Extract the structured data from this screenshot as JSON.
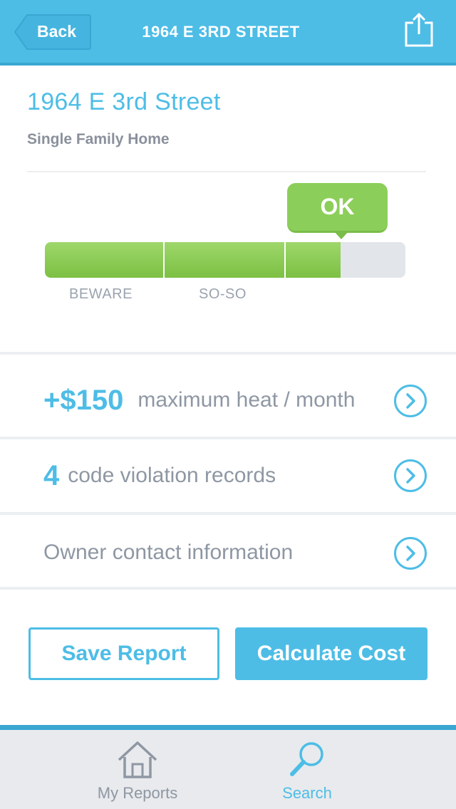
{
  "header": {
    "back_label": "Back",
    "title": "1964 E 3RD STREET",
    "share_icon": "share-icon"
  },
  "property": {
    "address": "1964 E 3rd Street",
    "type": "Single Family Home"
  },
  "rating": {
    "current_label": "OK",
    "fill_fraction": 0.82,
    "scale_labels": [
      "BEWARE",
      "SO-SO"
    ]
  },
  "rows": [
    {
      "value": "+$150",
      "label": "maximum heat / month"
    },
    {
      "value": "4",
      "label": "code violation records"
    },
    {
      "value": "",
      "label": "Owner contact information"
    }
  ],
  "actions": {
    "save_label": "Save Report",
    "calculate_label": "Calculate Cost"
  },
  "tabs": [
    {
      "label": "My Reports",
      "icon": "home-icon",
      "active": false
    },
    {
      "label": "Search",
      "icon": "search-icon",
      "active": true
    }
  ],
  "colors": {
    "accent": "#4dbde6",
    "accent_dark": "#3aa6d2",
    "good": "#8cce5a",
    "muted_text": "#8e97a3"
  }
}
